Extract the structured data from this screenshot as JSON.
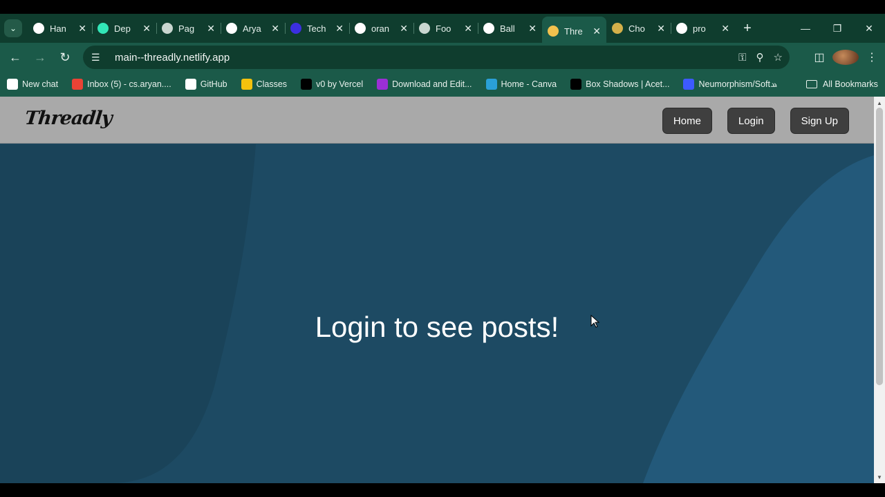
{
  "browser": {
    "tabs": [
      {
        "title": "Han",
        "icon": "threads-icon",
        "color": "#ffffff"
      },
      {
        "title": "Dep",
        "icon": "netlify-icon",
        "color": "#32e6b7"
      },
      {
        "title": "Pag",
        "icon": "globe-icon",
        "color": "#c9d6d0"
      },
      {
        "title": "Arya",
        "icon": "github-icon",
        "color": "#ffffff"
      },
      {
        "title": "Tech",
        "icon": "vercel-v-icon",
        "color": "#3b2fe0"
      },
      {
        "title": "oran",
        "icon": "google-icon",
        "color": "#ffffff"
      },
      {
        "title": "Foo",
        "icon": "globe-icon",
        "color": "#c9d6d0"
      },
      {
        "title": "Ball",
        "icon": "wikipedia-icon",
        "color": "#ffffff"
      },
      {
        "title": "Thre",
        "icon": "threadly-icon",
        "color": "#f2c14e",
        "active": true
      },
      {
        "title": "Cho",
        "icon": "medium-icon",
        "color": "#d4b04a"
      },
      {
        "title": "pro",
        "icon": "google-icon",
        "color": "#ffffff"
      }
    ],
    "url": "main--threadly.netlify.app",
    "bookmarks": [
      {
        "label": "New chat",
        "icon": "openai-icon",
        "color": "#ffffff"
      },
      {
        "label": "Inbox (5) - cs.aryan....",
        "icon": "gmail-icon",
        "color": "#ea4335"
      },
      {
        "label": "GitHub",
        "icon": "github-icon",
        "color": "#ffffff"
      },
      {
        "label": "Classes",
        "icon": "classroom-icon",
        "color": "#f4c20d"
      },
      {
        "label": "v0 by Vercel",
        "icon": "v0-icon",
        "color": "#000000"
      },
      {
        "label": "Download and Edit...",
        "icon": "canva-c-icon",
        "color": "#9b2fd6"
      },
      {
        "label": "Home - Canva",
        "icon": "canva-icon",
        "color": "#2aa0d8"
      },
      {
        "label": "Box Shadows | Acet...",
        "icon": "terminal-icon",
        "color": "#000000"
      },
      {
        "label": "Neumorphism/Soft...",
        "icon": "square-icon",
        "color": "#3d5afe"
      }
    ],
    "all_bookmarks": "All Bookmarks"
  },
  "site": {
    "logo": "Threadly",
    "nav": {
      "home": "Home",
      "login": "Login",
      "signup": "Sign Up"
    },
    "message": "Login to see posts!",
    "colors": {
      "header": "#a9a9a9",
      "background": "#1d4a63",
      "accent_shape": "#23597a",
      "dark_shape": "#1a4359"
    }
  }
}
